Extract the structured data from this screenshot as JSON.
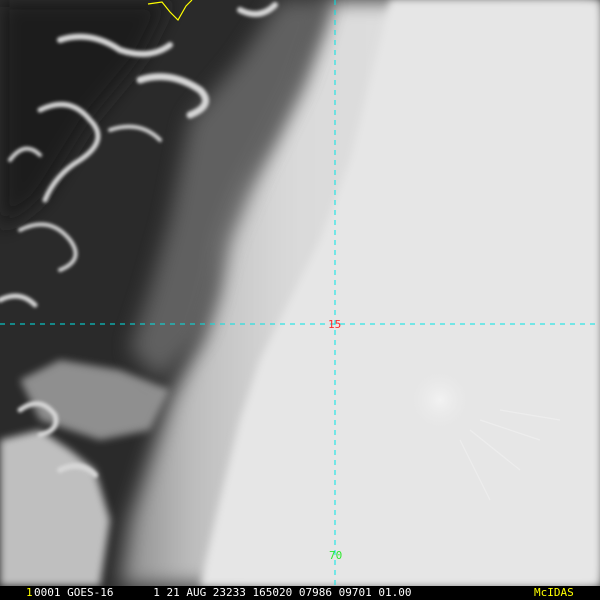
{
  "overlay": {
    "latitude_label": "15",
    "longitude_label": "70"
  },
  "status_bar": {
    "frame_number": "1",
    "image_info": "0001 GOES-16      1 21 AUG 23233 165020 07986 09701 01.00",
    "software": "McIDAS"
  },
  "colors": {
    "grid_line": "#00e5e5",
    "latitude_label": "#ff2a2a",
    "longitude_label": "#2ee82e",
    "coastline": "#ffff00",
    "frame_number": "#ffff00",
    "status_text": "#ffffff",
    "software_label": "#ffff00"
  }
}
